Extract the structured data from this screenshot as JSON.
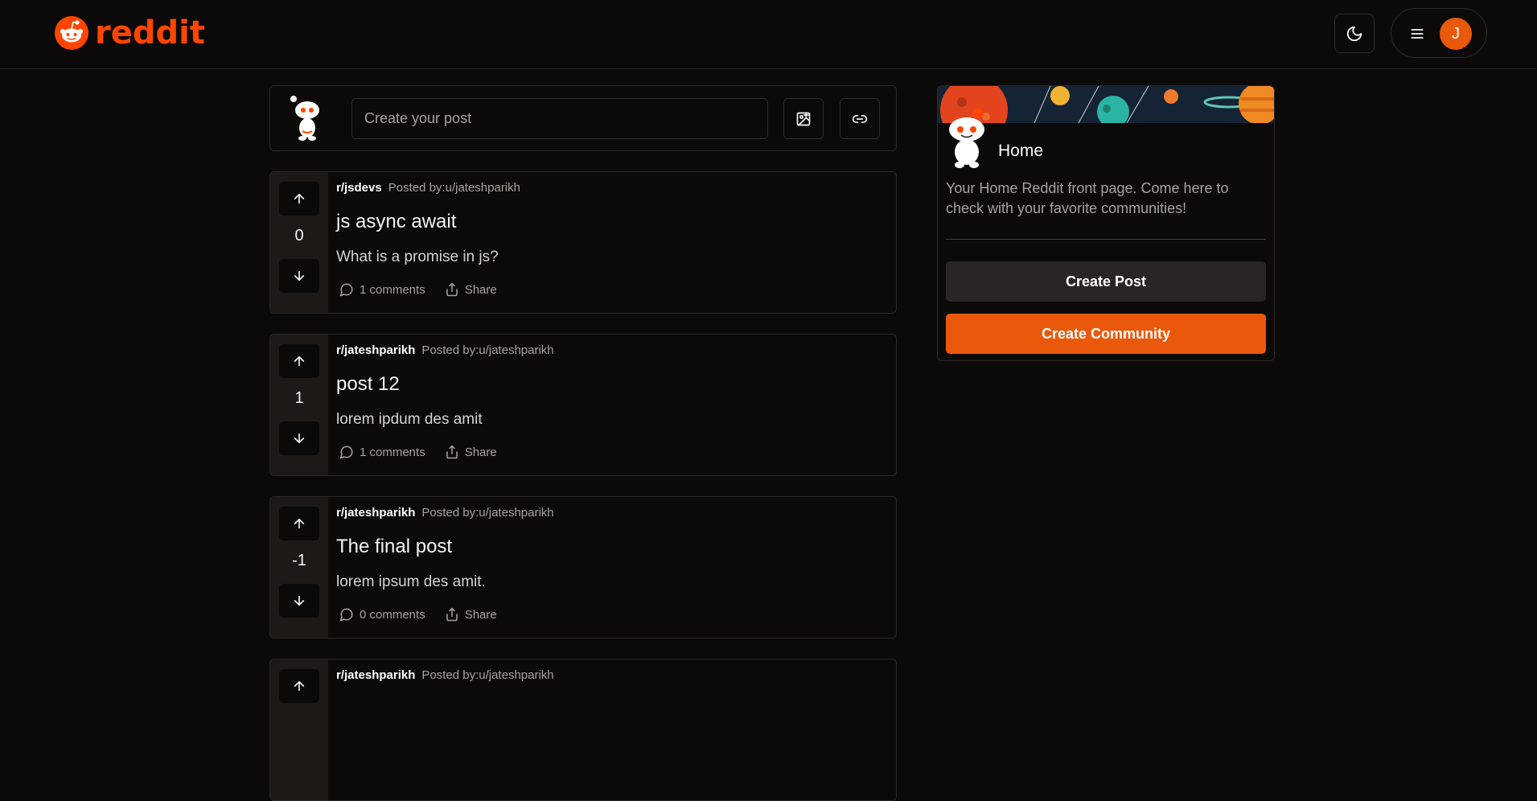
{
  "brand": {
    "name": "reddit",
    "color": "#ff4500"
  },
  "header": {
    "theme_icon": "moon-icon",
    "menu_icon": "hamburger-icon",
    "avatar_initial": "J"
  },
  "composer": {
    "placeholder": "Create your post",
    "image_icon": "image-upload-icon",
    "link_icon": "link-icon"
  },
  "posts": [
    {
      "subreddit": "r/jsdevs",
      "author": "Posted by:u/jateshparikh",
      "title": "js async await",
      "body": "What is a promise in js?",
      "votes": "0",
      "comments": "1 comments",
      "share": "Share"
    },
    {
      "subreddit": "r/jateshparikh",
      "author": "Posted by:u/jateshparikh",
      "title": "post 12",
      "body": "lorem ipdum des amit",
      "votes": "1",
      "comments": "1 comments",
      "share": "Share"
    },
    {
      "subreddit": "r/jateshparikh",
      "author": "Posted by:u/jateshparikh",
      "title": "The final post",
      "body": "lorem ipsum des amit.",
      "votes": "-1",
      "comments": "0 comments",
      "share": "Share"
    },
    {
      "subreddit": "r/jateshparikh",
      "author": "Posted by:u/jateshparikh"
    }
  ],
  "sidebar": {
    "title": "Home",
    "description": "Your Home Reddit front page. Come here to check with your favorite communities!",
    "create_post": "Create Post",
    "create_community": "Create Community",
    "accent": "#ea580c"
  }
}
